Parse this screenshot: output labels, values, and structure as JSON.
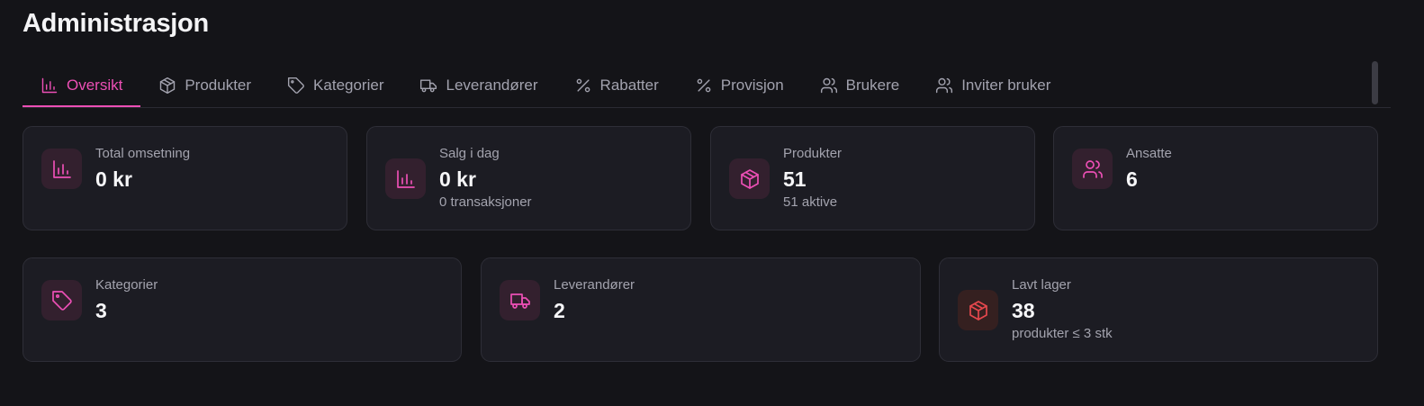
{
  "header": {
    "title": "Administrasjon"
  },
  "tabs": [
    {
      "label": "Oversikt",
      "icon": "bar-chart-icon"
    },
    {
      "label": "Produkter",
      "icon": "box-icon"
    },
    {
      "label": "Kategorier",
      "icon": "tag-icon"
    },
    {
      "label": "Leverandører",
      "icon": "truck-icon"
    },
    {
      "label": "Rabatter",
      "icon": "percent-icon"
    },
    {
      "label": "Provisjon",
      "icon": "percent-icon"
    },
    {
      "label": "Brukere",
      "icon": "users-icon"
    },
    {
      "label": "Inviter bruker",
      "icon": "users-icon"
    }
  ],
  "active_tab": "Oversikt",
  "colors": {
    "accent": "#ec4fb5",
    "warning": "#e5484d",
    "background": "#141418",
    "card": "#1c1c23"
  },
  "stats_row1": [
    {
      "label": "Total omsetning",
      "value": "0 kr",
      "sub": "",
      "icon": "bar-chart-icon"
    },
    {
      "label": "Salg i dag",
      "value": "0 kr",
      "sub": "0 transaksjoner",
      "icon": "bar-chart-icon"
    },
    {
      "label": "Produkter",
      "value": "51",
      "sub": "51 aktive",
      "icon": "box-icon"
    },
    {
      "label": "Ansatte",
      "value": "6",
      "sub": "",
      "icon": "users-icon"
    }
  ],
  "stats_row2": [
    {
      "label": "Kategorier",
      "value": "3",
      "sub": "",
      "icon": "tag-icon"
    },
    {
      "label": "Leverandører",
      "value": "2",
      "sub": "",
      "icon": "truck-icon"
    },
    {
      "label": "Lavt lager",
      "value": "38",
      "sub": "produkter ≤ 3 stk",
      "icon": "box-icon"
    }
  ]
}
